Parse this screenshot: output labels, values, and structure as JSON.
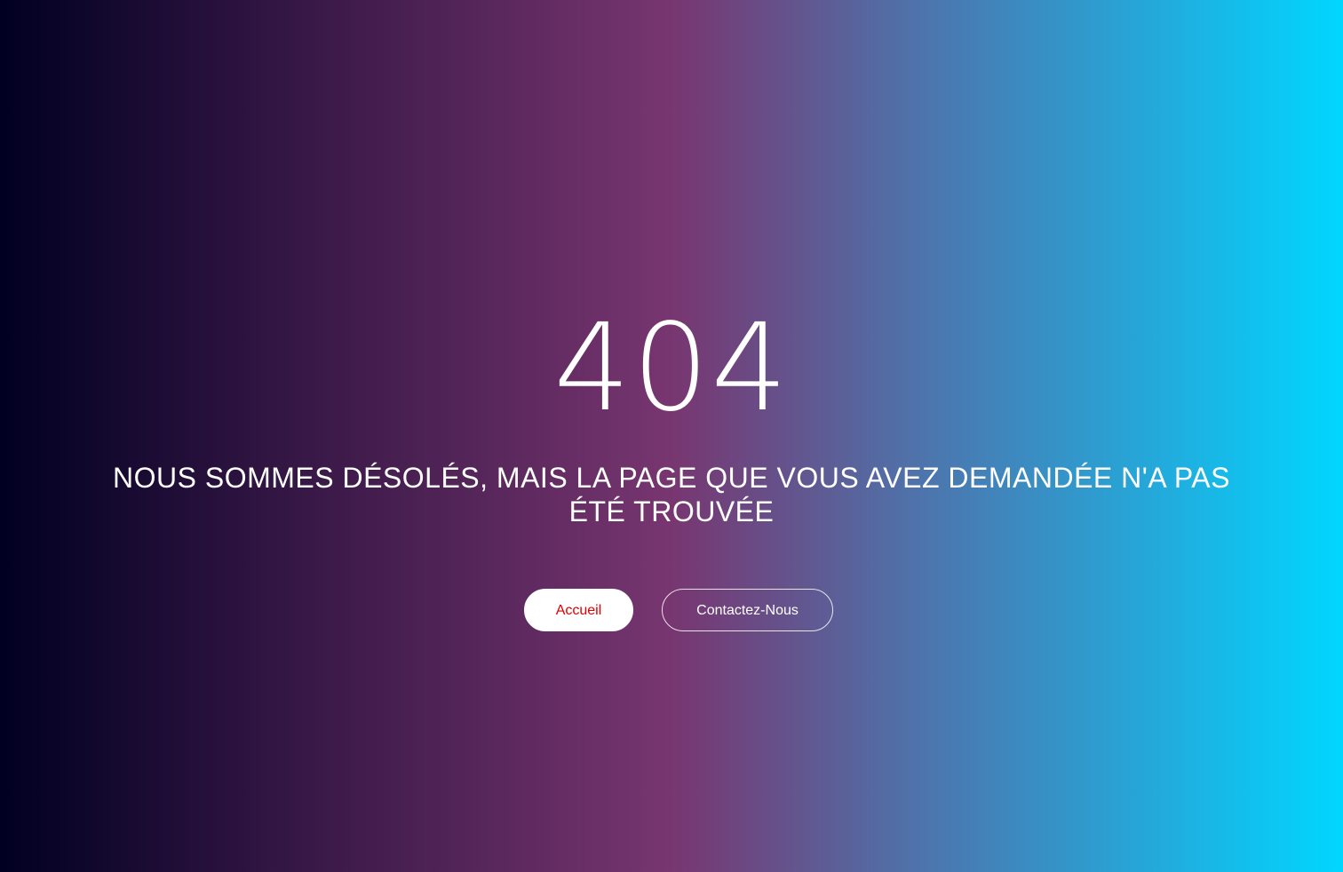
{
  "error": {
    "code": "404",
    "message": "NOUS SOMMES DÉSOLÉS, MAIS LA PAGE QUE VOUS AVEZ DEMANDÉE N'A PAS ÉTÉ TROUVÉE"
  },
  "actions": {
    "home_label": "Accueil",
    "contact_label": "Contactez-Nous"
  },
  "colors": {
    "gradient_start": "#000022",
    "gradient_mid": "#783670",
    "gradient_end": "#00d7ff",
    "home_text": "#e00000"
  }
}
